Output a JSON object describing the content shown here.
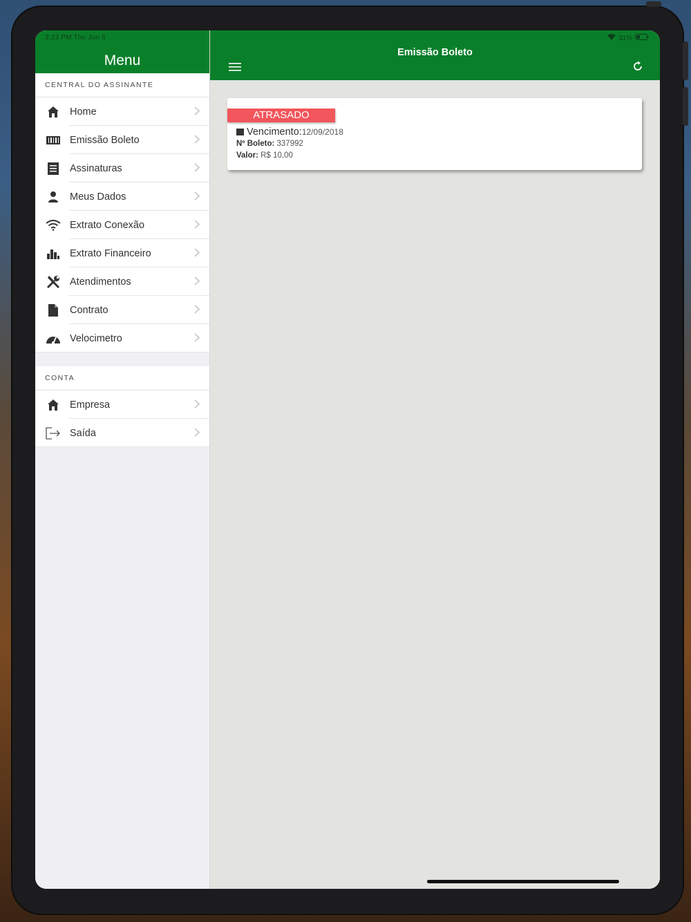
{
  "status_bar": {
    "time_date": "3:23 PM  Thu Jun 6",
    "battery": "31%"
  },
  "sidebar": {
    "title": "Menu",
    "sections": [
      {
        "header": "CENTRAL DO ASSINANTE",
        "items": [
          {
            "label": "Home",
            "icon": "home-icon"
          },
          {
            "label": "Emissão Boleto",
            "icon": "barcode-icon"
          },
          {
            "label": "Assinaturas",
            "icon": "document-list-icon"
          },
          {
            "label": "Meus Dados",
            "icon": "user-icon"
          },
          {
            "label": "Extrato Conexão",
            "icon": "wifi-icon"
          },
          {
            "label": "Extrato Financeiro",
            "icon": "bar-chart-icon"
          },
          {
            "label": "Atendimentos",
            "icon": "tools-icon"
          },
          {
            "label": "Contrato",
            "icon": "file-icon"
          },
          {
            "label": "Velocimetro",
            "icon": "speedometer-icon"
          }
        ]
      },
      {
        "header": "CONTA",
        "items": [
          {
            "label": "Empresa",
            "icon": "building-icon"
          },
          {
            "label": "Saída",
            "icon": "logout-icon"
          }
        ]
      }
    ]
  },
  "main": {
    "title": "Emissão Boleto",
    "card": {
      "status": "ATRASADO",
      "vencimento_label": "Vencimento:",
      "vencimento_value": "12/09/2018",
      "boleto_label": "Nº Boleto:",
      "boleto_value": "337992",
      "valor_label": "Valor:",
      "valor_value": "R$ 10,00"
    }
  },
  "colors": {
    "header_green": "#0a7f2a",
    "badge_red": "#f2555b",
    "content_bg": "#e3e3e0",
    "sidebar_bg": "#efeff4"
  }
}
